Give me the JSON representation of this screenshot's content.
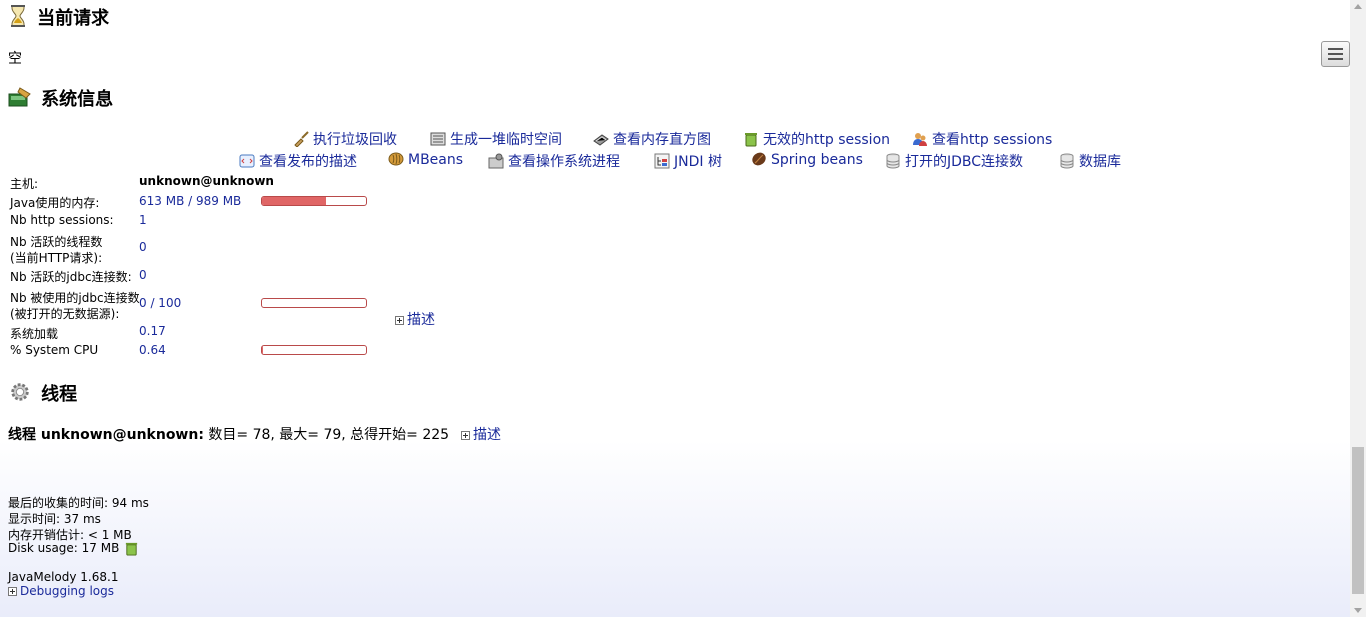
{
  "current_requests": {
    "title": "当前请求",
    "empty_text": "空"
  },
  "system_info": {
    "title": "系统信息",
    "actions_row1": [
      {
        "label": "执行垃圾回收",
        "icon": "broom-icon"
      },
      {
        "label": "生成一堆临时空间",
        "icon": "heap-icon"
      },
      {
        "label": "查看内存直方图",
        "icon": "memory-icon"
      },
      {
        "label": "无效的http session",
        "icon": "trash-icon"
      },
      {
        "label": "查看http sessions",
        "icon": "users-icon"
      }
    ],
    "actions_row2": [
      {
        "label": "查看发布的描述",
        "icon": "xml-icon"
      },
      {
        "label": "MBeans",
        "icon": "mbeans-icon"
      },
      {
        "label": "查看操作系统进程",
        "icon": "process-icon"
      },
      {
        "label": "JNDI 树",
        "icon": "tree-icon"
      },
      {
        "label": "Spring beans",
        "icon": "bean-icon"
      },
      {
        "label": "打开的JDBC连接数",
        "icon": "db-icon"
      },
      {
        "label": "数据库",
        "icon": "database-icon"
      }
    ],
    "rows": {
      "host": {
        "label": "主机:",
        "value": "unknown@unknown"
      },
      "java_memory": {
        "label": "Java使用的内存:",
        "value": "613 MB / 989 MB",
        "fraction": 0.62
      },
      "http_sessions": {
        "label": "Nb http sessions:",
        "value": "1"
      },
      "active_threads": {
        "label1": "Nb 活跃的线程数",
        "label2": "(当前HTTP请求):",
        "value": "0"
      },
      "active_jdbc": {
        "label": "Nb 活跃的jdbc连接数:",
        "value": "0"
      },
      "used_jdbc": {
        "label1": "Nb 被使用的jdbc连接数",
        "label2": "(被打开的无数据源):",
        "value": "0 / 100",
        "fraction": 0.0
      },
      "system_load": {
        "label": "系统加载",
        "value": "0.17"
      },
      "system_cpu": {
        "label": "% System CPU",
        "value": "0.64",
        "fraction": 0.006
      }
    },
    "details_label": "描述"
  },
  "threads": {
    "title": "线程",
    "label_bold": "线程 unknown@unknown:",
    "summary": "数目= 78, 最大= 79, 总得开始= 225",
    "details_label": "描述"
  },
  "footer": {
    "last_collect": "最后的收集的时间: 94 ms",
    "display_time": "显示时间: 37 ms",
    "memory_estimate": "内存开销估计: < 1 MB",
    "disk_usage": "Disk usage: 17 MB",
    "version": "JavaMelody 1.68.1",
    "debugging_logs": "Debugging logs"
  },
  "colors": {
    "link": "#1a2a9a",
    "bar_fill": "#e06666",
    "bar_border": "#b94a4a"
  }
}
